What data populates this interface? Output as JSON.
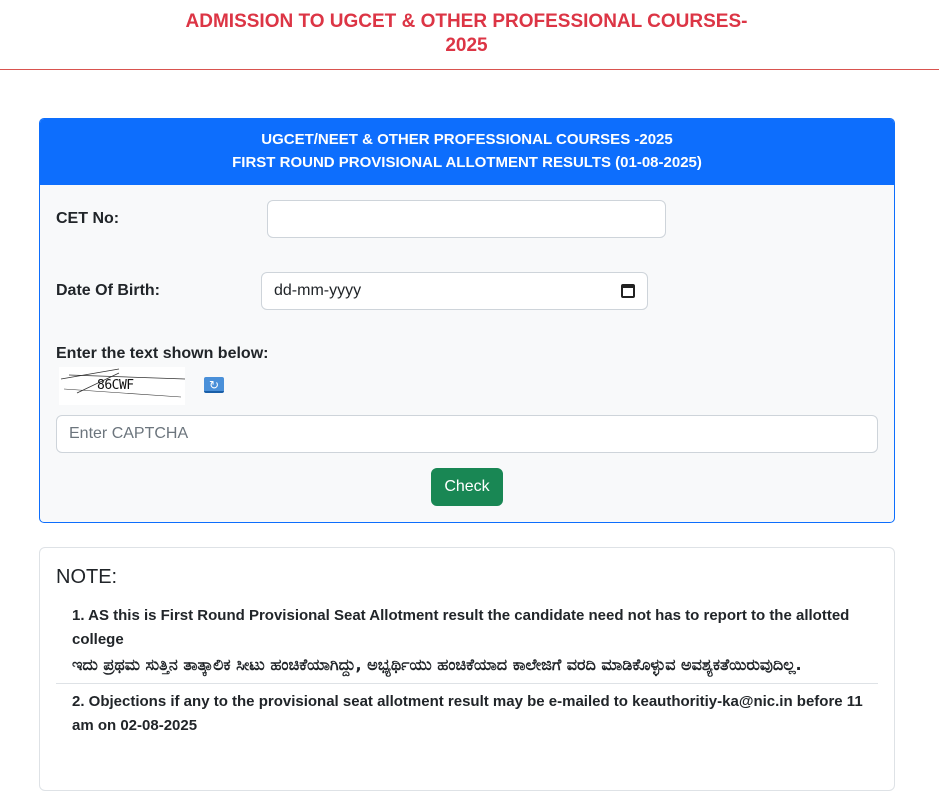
{
  "header": {
    "title_line1": "ADMISSION TO UGCET & OTHER PROFESSIONAL COURSES-",
    "title_line2": "2025"
  },
  "form_card": {
    "heading_line1": "UGCET/NEET & OTHER PROFESSIONAL COURSES -2025",
    "heading_line2": "FIRST ROUND PROVISIONAL ALLOTMENT RESULTS (01-08-2025)",
    "cet_label": "CET No:",
    "cet_value": "",
    "dob_label": "Date Of Birth:",
    "dob_placeholder": "dd-mm-yyyy",
    "captcha_label": "Enter the text shown below:",
    "captcha_text": "86CWF",
    "captcha_placeholder": "Enter CAPTCHA",
    "check_label": "Check"
  },
  "note": {
    "title": "NOTE:",
    "items": [
      {
        "en": "1. AS this is First Round Provisional Seat Allotment result the candidate need not has to report to the allotted college",
        "kn": "ಇದು ಪ್ರಥಮ ಸುತ್ತಿನ ತಾತ್ಕಾಲಿಕ ಸೀಟು ಹಂಚಿಕೆಯಾಗಿದ್ದು, ಅಭ್ಯರ್ಥಿಯು ಹಂಚಿಕೆಯಾದ ಕಾಲೇಜಿಗೆ ವರದಿ ಮಾಡಿಕೊಳ್ಳುವ ಅವಶ್ಯಕತೆಯಿರುವುದಿಲ್ಲ."
      },
      {
        "en": "2. Objections if any to the provisional seat allotment result may be e-mailed to keauthoritiy-ka@nic.in before 11 am on 02-08-2025"
      }
    ]
  },
  "icons": {
    "refresh": "refresh-icon",
    "calendar": "calendar-icon"
  },
  "colors": {
    "title_red": "#dc3545",
    "primary_blue": "#0d6efd",
    "success_green": "#198754"
  }
}
